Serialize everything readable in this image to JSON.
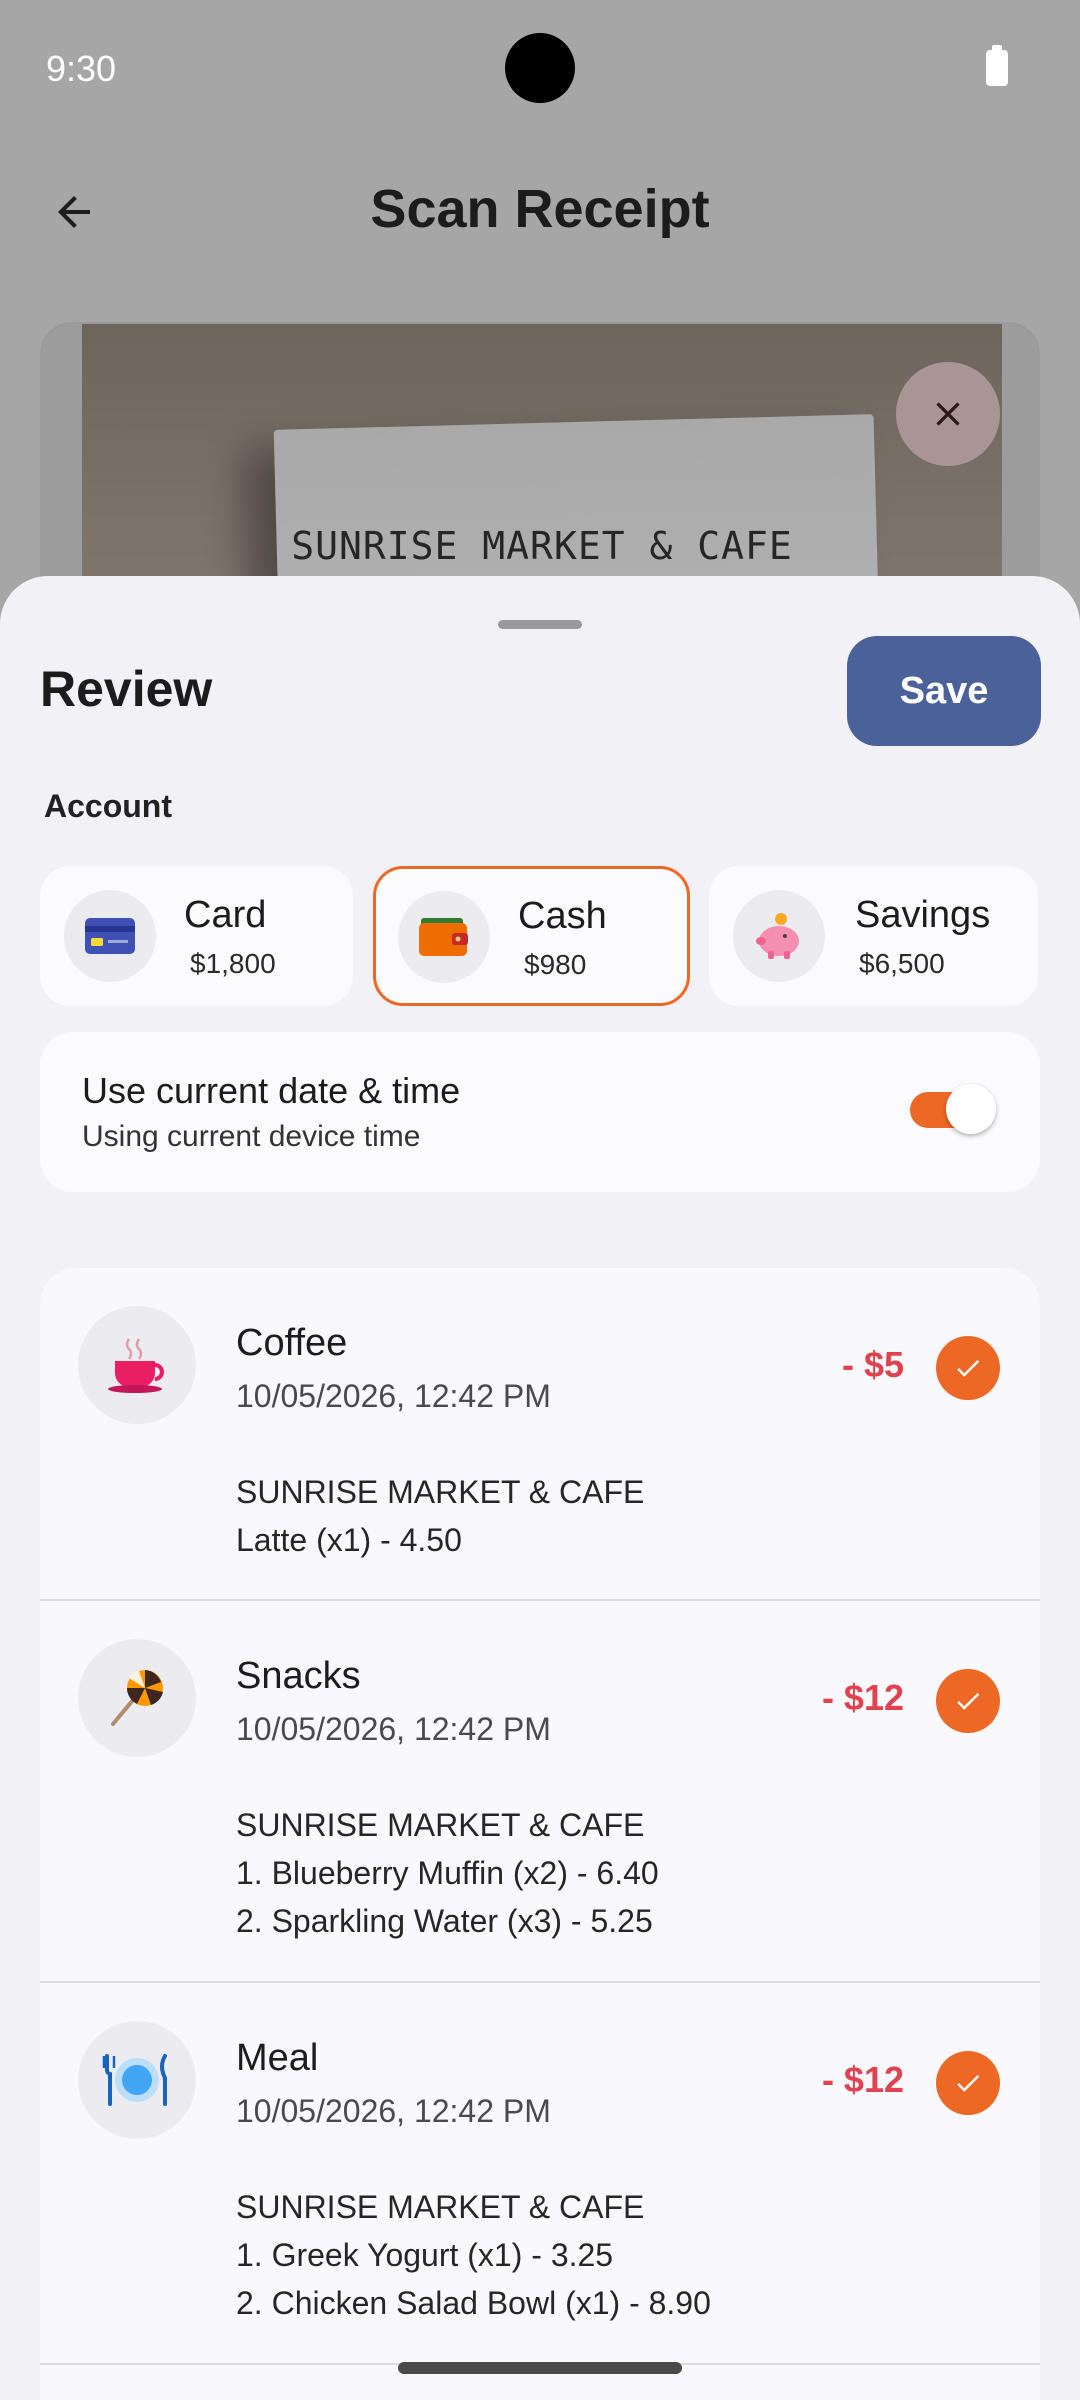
{
  "status_bar": {
    "time": "9:30"
  },
  "header": {
    "title": "Scan Receipt"
  },
  "receipt_preview": {
    "store_text": "SUNRISE MARKET & CAFE"
  },
  "sheet": {
    "title": "Review",
    "save_label": "Save",
    "account_label": "Account",
    "accounts": [
      {
        "name": "Card",
        "balance": "$1,800",
        "icon": "credit-card-icon",
        "selected": false
      },
      {
        "name": "Cash",
        "balance": "$980",
        "icon": "wallet-icon",
        "selected": true
      },
      {
        "name": "Savings",
        "balance": "$6,500",
        "icon": "piggy-bank-icon",
        "selected": false
      }
    ],
    "datetime": {
      "title": "Use current date & time",
      "subtitle": "Using current device time",
      "enabled": true
    },
    "transactions": [
      {
        "category": "Coffee",
        "icon": "coffee-cup-icon",
        "date": "10/05/2026, 12:42 PM",
        "amount": "- $5",
        "checked": true,
        "note_lines": [
          "SUNRISE MARKET & CAFE",
          "Latte (x1) - 4.50"
        ]
      },
      {
        "category": "Snacks",
        "icon": "lollipop-icon",
        "date": "10/05/2026, 12:42 PM",
        "amount": "- $12",
        "checked": true,
        "note_lines": [
          "SUNRISE MARKET & CAFE",
          "1. Blueberry Muffin (x2) - 6.40",
          "2. Sparkling Water (x3) - 5.25"
        ]
      },
      {
        "category": "Meal",
        "icon": "plate-cutlery-icon",
        "date": "10/05/2026, 12:42 PM",
        "amount": "- $12",
        "checked": true,
        "note_lines": [
          "SUNRISE MARKET & CAFE",
          "1. Greek Yogurt (x1) - 3.25",
          "2. Chicken Salad Bowl (x1) - 8.90"
        ]
      }
    ]
  },
  "colors": {
    "accent": "#ec6824",
    "primary_button": "#4b6199",
    "expense": "#e0424f",
    "sheet_bg": "#f2f1f6"
  }
}
